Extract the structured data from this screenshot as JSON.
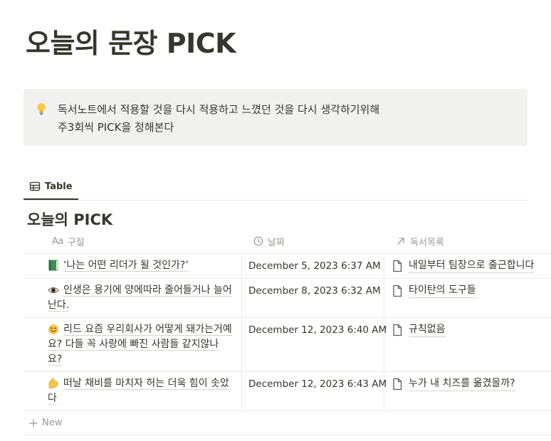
{
  "page": {
    "title": "오늘의 문장 PICK"
  },
  "callout": {
    "icon": "lightbulb-icon",
    "line1": "독서노트에서 적용할 것을 다시 적용하고 느꼈던 것을 다시 생각하기위해",
    "line2": "주3회씩 PICK을 정해본다"
  },
  "view_tabs": [
    {
      "label": "Table",
      "icon": "table-icon",
      "active": true
    }
  ],
  "database": {
    "title": "오늘의 PICK",
    "columns": [
      {
        "label": "구절",
        "icon": "text-property-icon",
        "icon_text": "Aa"
      },
      {
        "label": "날짜",
        "icon": "clock-icon"
      },
      {
        "label": "독서목록",
        "icon": "relation-arrow-icon"
      }
    ],
    "rows": [
      {
        "emoji": "green-book-icon",
        "title": "‘나는 어떤 리더가 될 것인가?’",
        "date": "December 5, 2023 6:37 AM",
        "relation": "내일부터 팀장으로 출근합니다"
      },
      {
        "emoji": "eye-icon",
        "title": "인생은 용기에 양에따라 줄어들거나 늘어난다.",
        "date": "December 8, 2023 6:32 AM",
        "relation": "타이탄의 도구들"
      },
      {
        "emoji": "smiling-face-icon",
        "title": "리드  요즘 우리회사가 어떻게 돼가는거예요? 다들 꼭 사랑에 빠진 사람들 같지않나요?",
        "date": "December 12, 2023 6:40 AM",
        "relation": "규칙없음"
      },
      {
        "emoji": "flexed-biceps-icon",
        "title": "떠날 채비를 마치자 허는 더욱 힘이 솟았다",
        "date": "December 12, 2023 6:43 AM",
        "relation": "누가 내 치즈를 옮겼을까?"
      }
    ],
    "new_label": "New"
  },
  "colors": {
    "text": "#37352f",
    "muted": "#9b9a97",
    "callout_bg": "#f1f1ef",
    "border": "#e9e9e7"
  }
}
